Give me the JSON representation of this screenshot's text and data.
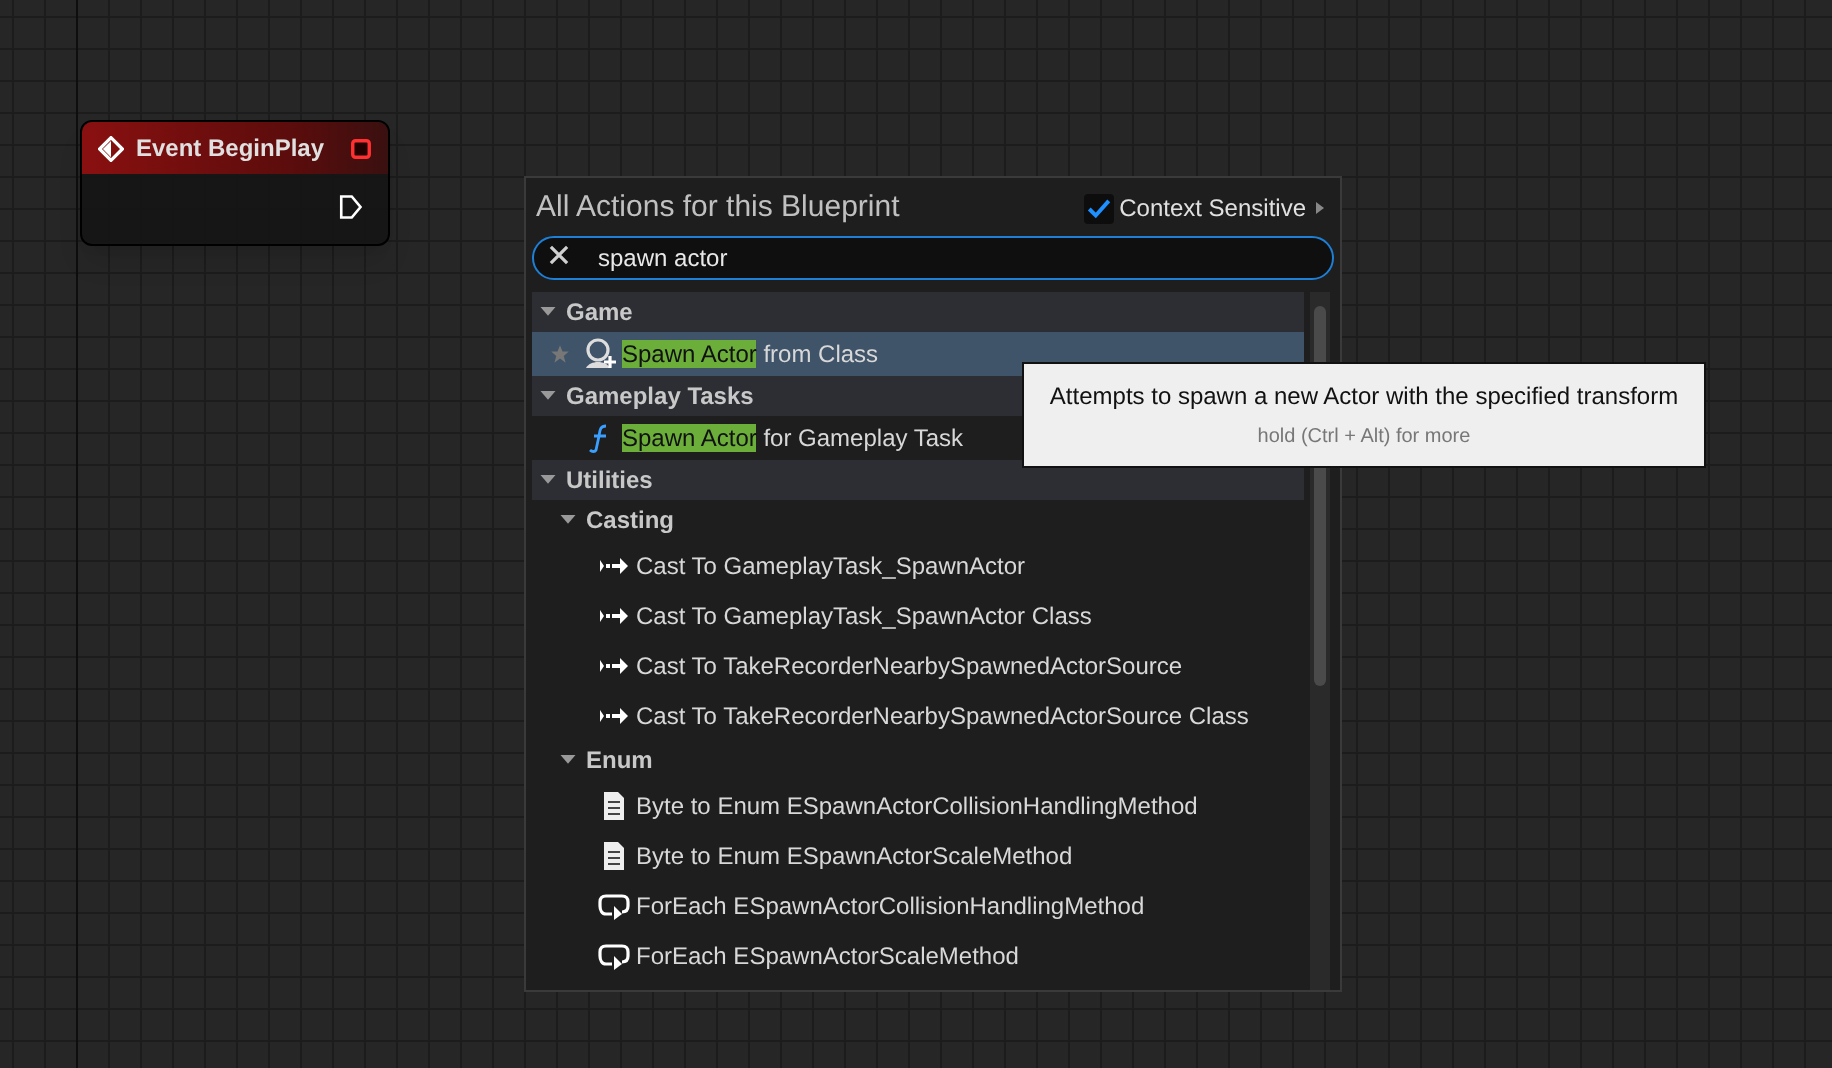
{
  "node": {
    "title": "Event BeginPlay"
  },
  "menu": {
    "title": "All Actions for this Blueprint",
    "context_sensitive": {
      "label": "Context Sensitive",
      "checked": true
    },
    "search": {
      "value": "spawn actor"
    },
    "tree": [
      {
        "label": "Game",
        "expanded": true,
        "children": [
          {
            "kind": "spawn",
            "match": "Spawn Actor",
            "rest": " from Class",
            "selected": true
          }
        ]
      },
      {
        "label": "Gameplay Tasks",
        "expanded": true,
        "children": [
          {
            "kind": "function",
            "match": "Spawn Actor",
            "rest": " for Gameplay Task",
            "selected": false
          }
        ]
      },
      {
        "label": "Utilities",
        "expanded": true,
        "children": [
          {
            "label": "Casting",
            "expanded": true,
            "children": [
              {
                "kind": "cast",
                "text": "Cast To GameplayTask_SpawnActor",
                "selected": false
              },
              {
                "kind": "cast",
                "text": "Cast To GameplayTask_SpawnActor Class",
                "selected": false
              },
              {
                "kind": "cast",
                "text": "Cast To TakeRecorderNearbySpawnedActorSource",
                "selected": false
              },
              {
                "kind": "cast",
                "text": "Cast To TakeRecorderNearbySpawnedActorSource Class",
                "selected": false
              }
            ]
          },
          {
            "label": "Enum",
            "expanded": true,
            "children": [
              {
                "kind": "enum",
                "text": "Byte to Enum ESpawnActorCollisionHandlingMethod",
                "selected": false
              },
              {
                "kind": "enum",
                "text": "Byte to Enum ESpawnActorScaleMethod",
                "selected": false
              },
              {
                "kind": "foreach",
                "text": "ForEach ESpawnActorCollisionHandlingMethod",
                "selected": false
              },
              {
                "kind": "foreach",
                "text": "ForEach ESpawnActorScaleMethod",
                "selected": false
              }
            ]
          }
        ]
      }
    ]
  },
  "tooltip": {
    "text": "Attempts to spawn a new Actor with the specified transform",
    "hint": "hold (Ctrl + Alt) for more"
  }
}
